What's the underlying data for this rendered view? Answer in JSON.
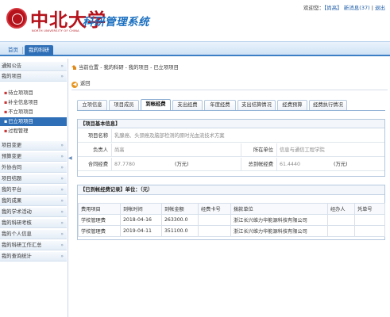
{
  "header": {
    "logo_text": "中北大学",
    "logo_sub": "NORTH UNIVERSITY OF CHINA",
    "system_title": "科研管理系统",
    "welcome_prefix": "欢迎您：",
    "user_name": "【尚高】",
    "messages": "新消息(37)",
    "logout": "退出"
  },
  "nav": {
    "tabs": [
      {
        "label": "首页",
        "active": false
      },
      {
        "label": "我的科研",
        "active": true
      }
    ]
  },
  "sidebar": {
    "items": [
      {
        "type": "group",
        "label": "通知公告"
      },
      {
        "type": "group",
        "label": "我的项目"
      },
      {
        "type": "sub",
        "label": "待立项项目"
      },
      {
        "type": "sub",
        "label": "补全信息项目"
      },
      {
        "type": "sub",
        "label": "不立项项目"
      },
      {
        "type": "sub",
        "label": "已立项项目",
        "selected": true
      },
      {
        "type": "sub",
        "label": "过程管理"
      },
      {
        "type": "group",
        "label": "项目变更"
      },
      {
        "type": "group",
        "label": "预算变更"
      },
      {
        "type": "group",
        "label": "外协合同"
      },
      {
        "type": "group",
        "label": "项目结题"
      },
      {
        "type": "group",
        "label": "我的平台"
      },
      {
        "type": "group",
        "label": "我的成果"
      },
      {
        "type": "group",
        "label": "我的学术活动"
      },
      {
        "type": "group",
        "label": "我的科研考核"
      },
      {
        "type": "group",
        "label": "我的个人信息"
      },
      {
        "type": "group",
        "label": "我的科研工作汇总"
      },
      {
        "type": "group",
        "label": "我的查询统计"
      }
    ],
    "chevron": "»",
    "collapse": "◀"
  },
  "main": {
    "breadcrumb": "当前位置 - 我的科研 - 我的项目 - 已立项项目",
    "back_label": "返回",
    "tabs": [
      {
        "label": "立项信息"
      },
      {
        "label": "项目成员"
      },
      {
        "label": "到帐经费",
        "active": true
      },
      {
        "label": "支出经费"
      },
      {
        "label": "年度经费"
      },
      {
        "label": "支出结算情况"
      },
      {
        "label": "经费预算"
      },
      {
        "label": "经费执行情况"
      }
    ],
    "basic": {
      "heading": "【项目基本信息】",
      "name_label": "项目名称",
      "name_value": "乳腺癌、头颈癌及脑部检测的原时光血流技术方案",
      "leader_label": "负责人",
      "leader_value": "尚高",
      "unit_label": "所在单位",
      "unit_value": "信息与通信工程学院",
      "contract_label": "合同经费",
      "contract_value": "87.7780",
      "contract_unit": "(万元)",
      "received_label": "总到帐经费",
      "received_value": "61.4440",
      "received_unit": "(万元)"
    },
    "funds": {
      "heading": "【已到帐经费记录】单位：（元）",
      "columns": [
        "费用项目",
        "到帐时间",
        "到帐金额",
        "经费卡号",
        "拨款单位",
        "经办人",
        "凭单号"
      ],
      "rows": [
        [
          "学校管理费",
          "2018-04-16",
          "263300.0",
          "",
          "浙江长兴维力华能源科技有限公司",
          "",
          ""
        ],
        [
          "学校管理费",
          "2019-04-11",
          "351100.0",
          "",
          "浙江长兴维力华能源科技有限公司",
          "",
          ""
        ]
      ]
    }
  },
  "colors": {
    "brand_red": "#b5121b",
    "title_blue": "#1a6fc0",
    "nav_active": "#2f6fb7"
  }
}
